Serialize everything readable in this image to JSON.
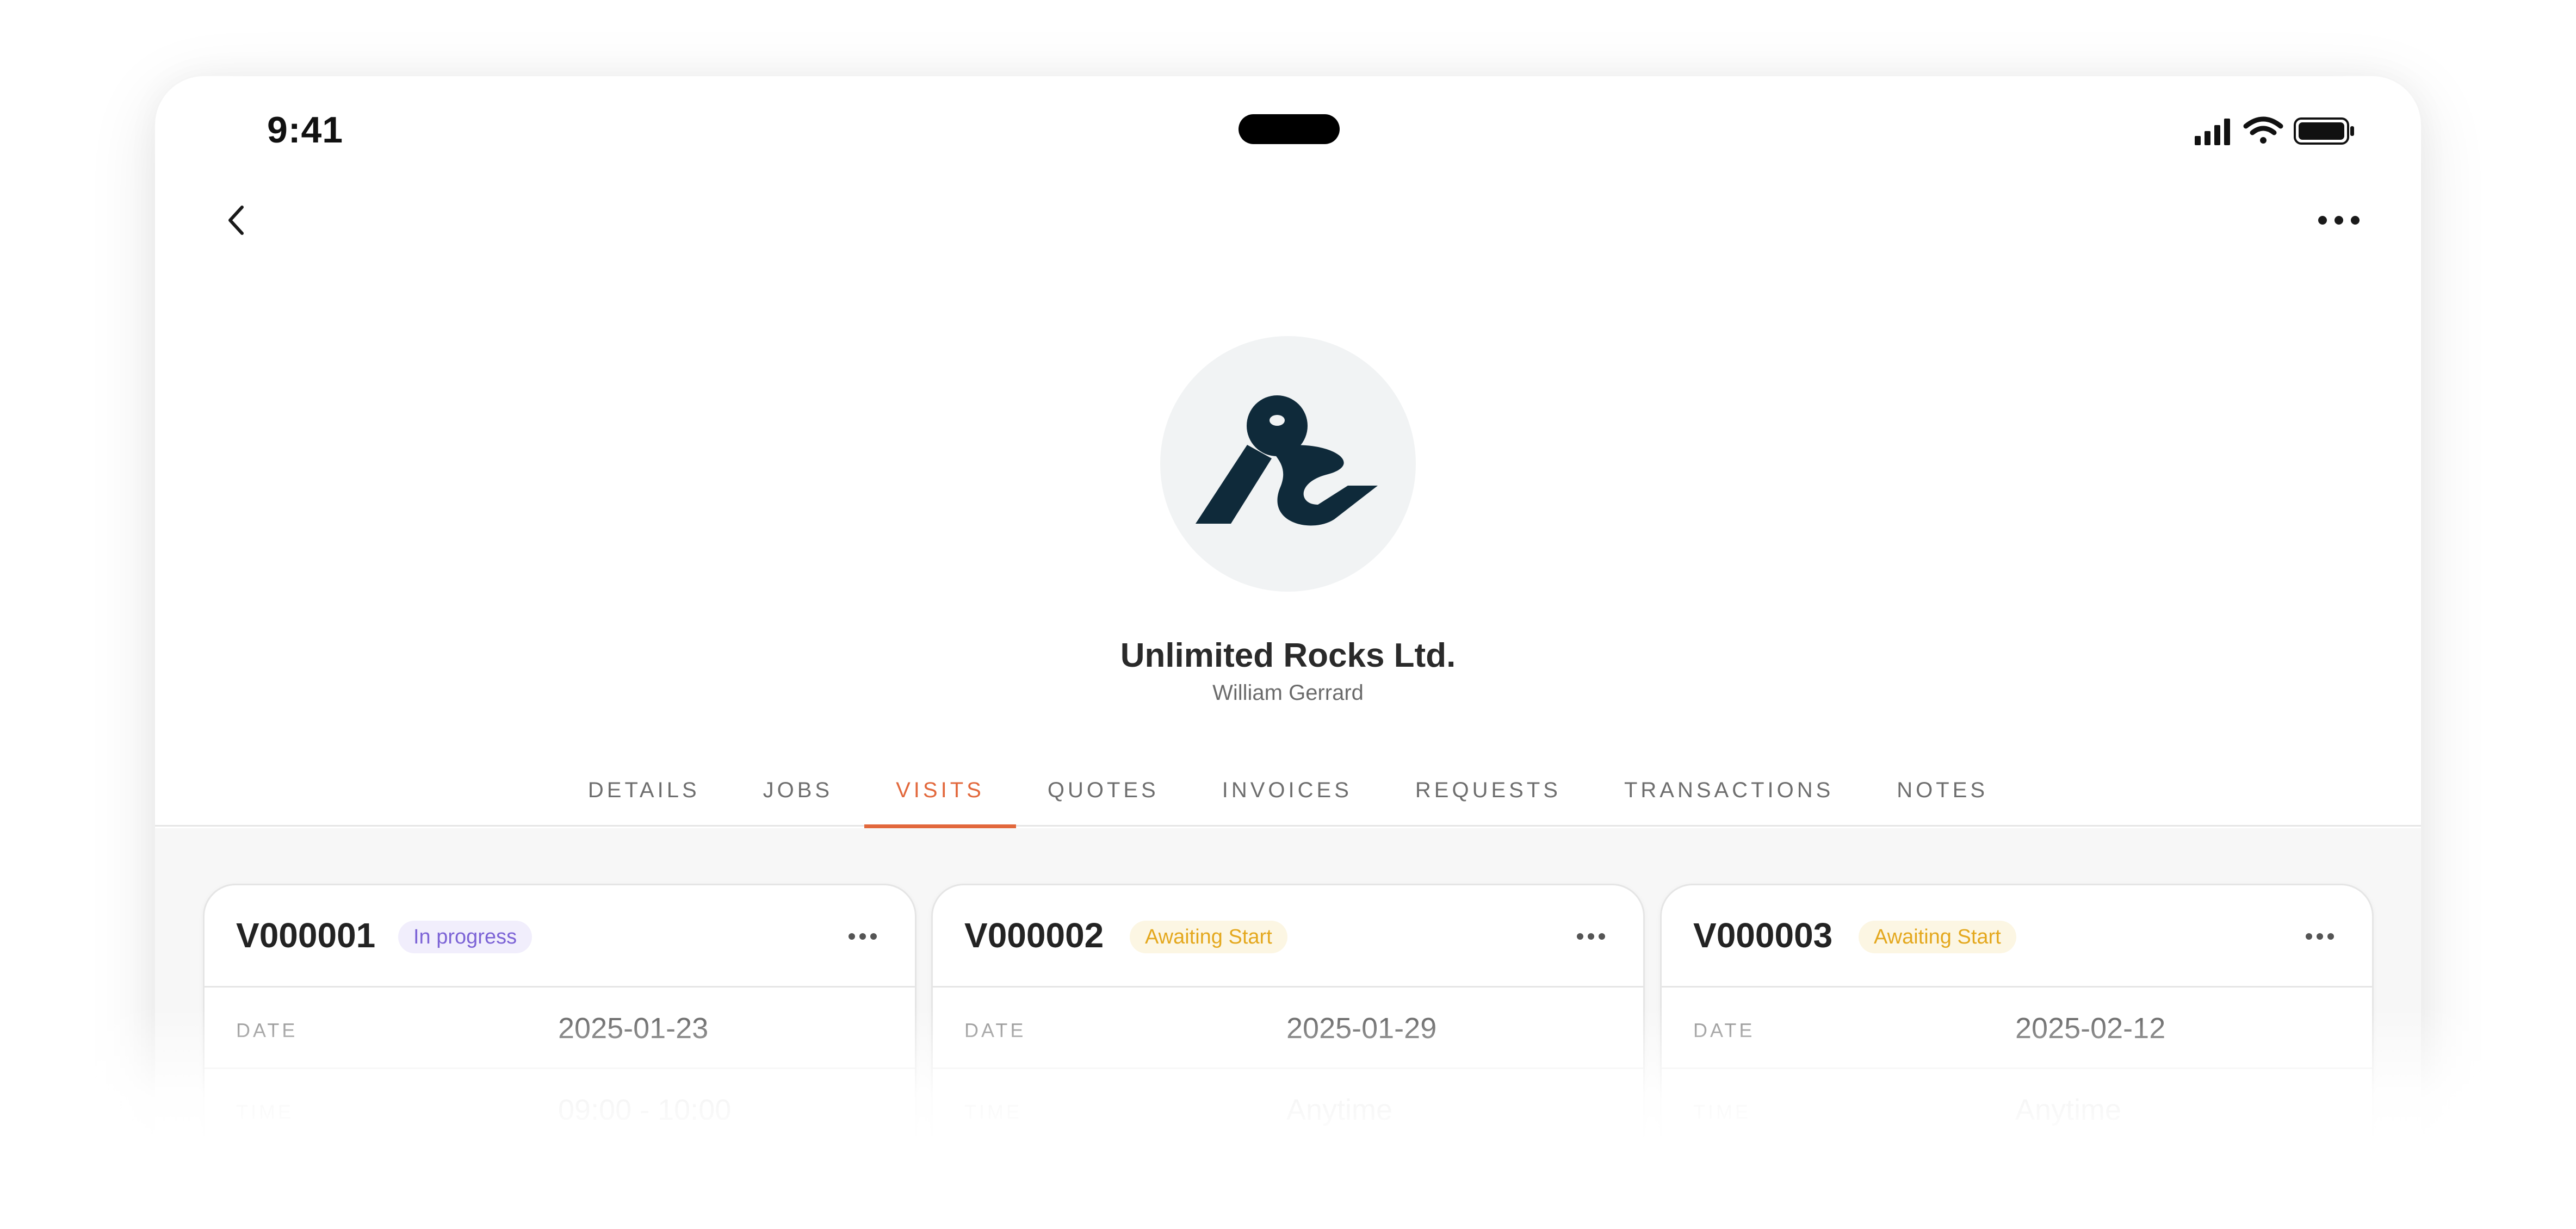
{
  "status_bar": {
    "time": "9:41",
    "icons": [
      "signal-icon",
      "wifi-icon",
      "battery-icon"
    ]
  },
  "nav": {
    "back_icon": "chevron-left-icon",
    "more_icon": "more-horizontal-icon"
  },
  "client": {
    "company": "Unlimited Rocks Ltd.",
    "contact": "William Gerrard",
    "logo_color": "#0f2a3a"
  },
  "tabs": [
    {
      "label": "DETAILS",
      "active": false
    },
    {
      "label": "JOBS",
      "active": false
    },
    {
      "label": "VISITS",
      "active": true
    },
    {
      "label": "QUOTES",
      "active": false
    },
    {
      "label": "INVOICES",
      "active": false
    },
    {
      "label": "REQUESTS",
      "active": false
    },
    {
      "label": "TRANSACTIONS",
      "active": false
    },
    {
      "label": "NOTES",
      "active": false
    }
  ],
  "visits": [
    {
      "id": "V000001",
      "status": "In progress",
      "status_type": "progress",
      "rows": [
        {
          "label": "DATE",
          "value": "2025-01-23"
        },
        {
          "label": "TIME",
          "value": "09:00 - 10:00"
        }
      ]
    },
    {
      "id": "V000002",
      "status": "Awaiting Start",
      "status_type": "awaiting",
      "rows": [
        {
          "label": "DATE",
          "value": "2025-01-29"
        },
        {
          "label": "TIME",
          "value": "Anytime"
        }
      ]
    },
    {
      "id": "V000003",
      "status": "Awaiting Start",
      "status_type": "awaiting",
      "rows": [
        {
          "label": "DATE",
          "value": "2025-02-12"
        },
        {
          "label": "TIME",
          "value": "Anytime"
        }
      ]
    }
  ],
  "colors": {
    "accent": "#e2683c",
    "in_progress_text": "#7c63d6",
    "in_progress_bg": "#f1eefc",
    "awaiting_text": "#e4a81e",
    "awaiting_bg": "#fcf6e3"
  }
}
